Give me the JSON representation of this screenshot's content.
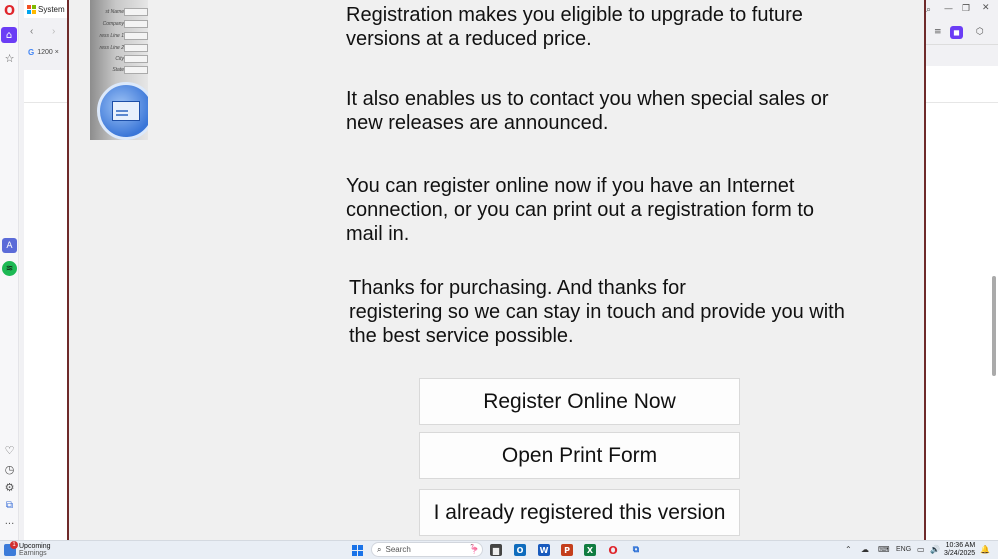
{
  "browser": {
    "left_tab_title": "System d",
    "bookmark_left": "1200 ×",
    "icons": {
      "opera_logo": "O",
      "home": "⌂",
      "bookmark": "☆",
      "aria": "A",
      "spotify": "≋",
      "heart": "♡",
      "history": "◷",
      "settings": "⚙",
      "extensions": "⧉",
      "more": "···",
      "back": "‹",
      "forward": "›",
      "search": "⌕",
      "minimize": "—",
      "restore": "❐",
      "close": "✕",
      "menu": "≡",
      "profile": "◼",
      "ext_box": "⬡"
    }
  },
  "dialog": {
    "side_form_labels": [
      "st Name",
      "Company",
      "ress Line 1",
      "ress Line 2",
      "City",
      "State"
    ],
    "paragraphs": {
      "p1": [
        "Registration makes you eligible to upgrade to future",
        "versions at a reduced price."
      ],
      "p2": [
        "It also enables us to contact you when special sales or",
        "new releases are announced."
      ],
      "p3": [
        "You can register online now if you have an Internet",
        "connection, or you can print out a registration  form to",
        "mail in."
      ],
      "p4": [
        "Thanks for purchasing. And thanks for",
        "registering so we can stay in touch and provide you with",
        "the best service possible."
      ]
    },
    "buttons": {
      "register_online": "Register Online Now",
      "open_print_form": "Open Print Form",
      "already_registered": "I already registered this version"
    }
  },
  "taskbar": {
    "widget_title": "Upcoming",
    "widget_subtitle": "Earnings",
    "widget_badge": "1",
    "search_placeholder": "Search",
    "search_icon": "⌕",
    "search_art": "🦩",
    "apps": {
      "files": "▆",
      "outlook": "O",
      "word": "W",
      "powerpoint": "P",
      "excel": "X",
      "opera": "O",
      "snip": "⧉"
    },
    "tray": {
      "chevron": "⌃",
      "cloud": "☁",
      "keyboard": "⌨",
      "language": "ENG",
      "display": "▭",
      "volume": "🔊",
      "bell": "🔔"
    },
    "time": "10:36 AM",
    "date": "3/24/2025"
  }
}
